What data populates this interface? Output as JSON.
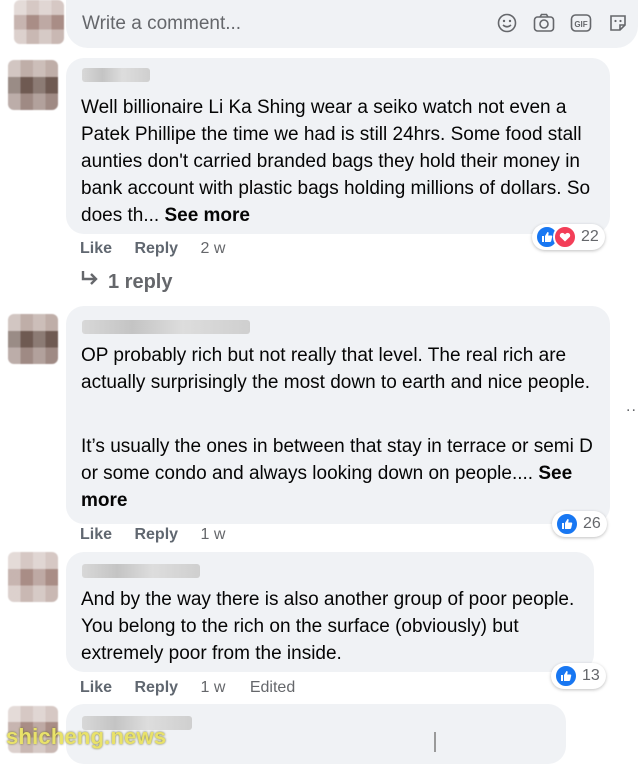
{
  "composer": {
    "placeholder": "Write a comment...",
    "icons": [
      "emoji-icon",
      "camera-icon",
      "gif-icon",
      "sticker-icon"
    ]
  },
  "comments": [
    {
      "text": "Well billionaire Li Ka Shing wear a seiko watch not even a Patek Phillipe the time we had is still 24hrs. Some food stall aunties don't carried branded bags they hold their money in bank account with plastic bags holding millions of dollars. So does th...",
      "see_more": "See more",
      "like": "Like",
      "reply": "Reply",
      "time": "2 w",
      "reactions": [
        "like",
        "love"
      ],
      "reaction_count": "22",
      "replies_label": "1 reply"
    },
    {
      "text_p1": "OP probably rich but not really that level. The real rich are actually surprisingly the most down to earth and nice people.",
      "text_p2": "It’s usually the ones in between that stay in terrace or semi D or some condo and always looking down on people....",
      "see_more": "See more",
      "like": "Like",
      "reply": "Reply",
      "time": "1 w",
      "reactions": [
        "like"
      ],
      "reaction_count": "26"
    },
    {
      "text": "And by the way there is also another group of poor people. You belong to the rich on the surface (obviously) but extremely poor from the inside.",
      "like": "Like",
      "reply": "Reply",
      "time": "1 w",
      "edited": "Edited",
      "reactions": [
        "like"
      ],
      "reaction_count": "13"
    }
  ],
  "side_dots": "..",
  "watermark": "shicheng.news",
  "colors": {
    "bubble": "#f0f2f5",
    "like_blue": "#1877f2",
    "love_red": "#f33e58",
    "meta_gray": "#65676b"
  }
}
